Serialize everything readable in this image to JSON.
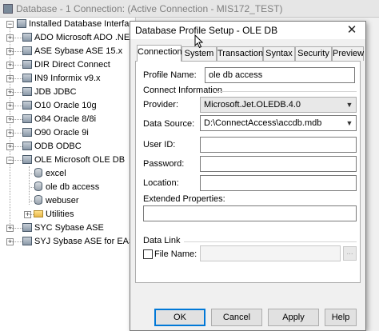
{
  "app": {
    "title": "Database - 1 Connection: (Active Connection - MIS172_TEST)"
  },
  "tree": {
    "root_label": "Installed Database Interfaces",
    "items": [
      {
        "label": "ADO Microsoft ADO .NET",
        "icon": "database-icon"
      },
      {
        "label": "ASE Sybase ASE 15.x",
        "icon": "database-icon"
      },
      {
        "label": "DIR Direct Connect",
        "icon": "database-icon"
      },
      {
        "label": "IN9 Informix v9.x",
        "icon": "database-icon"
      },
      {
        "label": "JDB JDBC",
        "icon": "database-icon"
      },
      {
        "label": "O10 Oracle 10g",
        "icon": "database-icon"
      },
      {
        "label": "O84 Oracle 8/8i",
        "icon": "database-icon"
      },
      {
        "label": "O90 Oracle 9i",
        "icon": "database-icon"
      },
      {
        "label": "ODB ODBC",
        "icon": "database-icon"
      },
      {
        "label": "OLE Microsoft OLE DB",
        "icon": "database-icon"
      },
      {
        "label": "excel",
        "icon": "db-profile-icon"
      },
      {
        "label": "ole db access",
        "icon": "db-profile-icon"
      },
      {
        "label": "webuser",
        "icon": "db-profile-icon"
      },
      {
        "label": "Utilities",
        "icon": "folder-icon"
      },
      {
        "label": "SYC Sybase ASE",
        "icon": "database-icon"
      },
      {
        "label": "SYJ Sybase ASE for EAServer",
        "icon": "database-icon"
      }
    ]
  },
  "dialog": {
    "title": "Database Profile Setup - OLE DB",
    "close_glyph": "✕",
    "tabs": [
      {
        "label": "Connection",
        "active": true
      },
      {
        "label": "System",
        "active": false
      },
      {
        "label": "Transaction",
        "active": false
      },
      {
        "label": "Syntax",
        "active": false
      },
      {
        "label": "Security",
        "active": false
      },
      {
        "label": "Preview",
        "active": false
      }
    ],
    "profile_name_label": "Profile Name:",
    "profile_name_value": "ole db access",
    "connect_info_label": "Connect Information",
    "provider_label": "Provider:",
    "provider_value": "Microsoft.Jet.OLEDB.4.0",
    "data_source_label": "Data Source:",
    "data_source_value": "D:\\ConnectAccess\\accdb.mdb",
    "user_id_label": "User ID:",
    "user_id_value": "",
    "password_label": "Password:",
    "password_value": "",
    "location_label": "Location:",
    "location_value": "",
    "extended_properties_label": "Extended Properties:",
    "extended_properties_value": "",
    "data_link_label": "Data Link",
    "file_name_label": "File Name:",
    "file_name_value": "",
    "file_name_checked": false,
    "browse_glyph": "...",
    "buttons": {
      "ok": "OK",
      "cancel": "Cancel",
      "apply": "Apply",
      "help": "Help"
    }
  }
}
